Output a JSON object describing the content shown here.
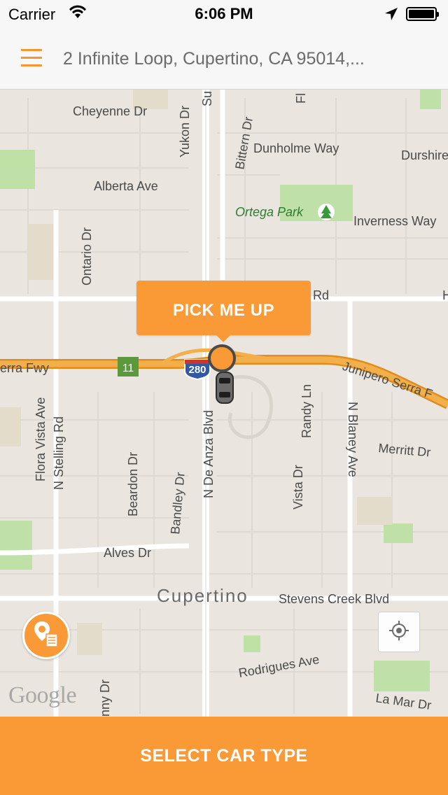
{
  "status_bar": {
    "carrier": "Carrier",
    "time": "6:06 PM",
    "icons": [
      "wifi-icon",
      "location-arrow-icon",
      "battery-icon"
    ]
  },
  "header": {
    "address": "2 Infinite Loop, Cupertino, CA 95014,...",
    "menu_icon": "hamburger-menu-icon"
  },
  "map": {
    "labels": {
      "cheyenne": "Cheyenne Dr",
      "yukon": "Yukon Dr",
      "bittern": "Bittern Dr",
      "dunholme": "Dunholme Way",
      "durshire": "Durshire",
      "alberta": "Alberta Ave",
      "ortega": "Ortega Park",
      "inverness": "Inverness Way",
      "ontario": "Ontario Dr",
      "rd": "Rd",
      "freeway_left": "erra Fwy",
      "junipero": "Junipero Serra F",
      "route_11": "11",
      "i280": "280",
      "flora": "Flora Vista Ave",
      "stelling": "N Stelling Rd",
      "deanza": "N De Anza Blvd",
      "randy": "Randy Ln",
      "blaney": "N Blaney Ave",
      "merritt": "Merritt Dr",
      "beardon": "Beardon Dr",
      "bandley": "Bandley Dr",
      "vista": "Vista Dr",
      "alves": "Alves Dr",
      "cupertino": "Cupertino",
      "stevens": "Stevens Creek Blvd",
      "rodrigues": "Rodrigues Ave",
      "lamar": "La Mar Dr",
      "nny": "nny Dr",
      "su": "Su",
      "fl": "Fl",
      "h": "H"
    },
    "google_logo": "Google"
  },
  "pickup": {
    "label": "PICK ME UP"
  },
  "controls": {
    "locate_icon": "crosshair-locate-icon",
    "places_icon": "map-pin-list-icon"
  },
  "footer": {
    "select_car_label": "SELECT CAR TYPE"
  },
  "colors": {
    "accent": "#f99a36",
    "freeway": "#f0a22e",
    "map_bg": "#eae6df",
    "park": "#bfe0a6"
  }
}
